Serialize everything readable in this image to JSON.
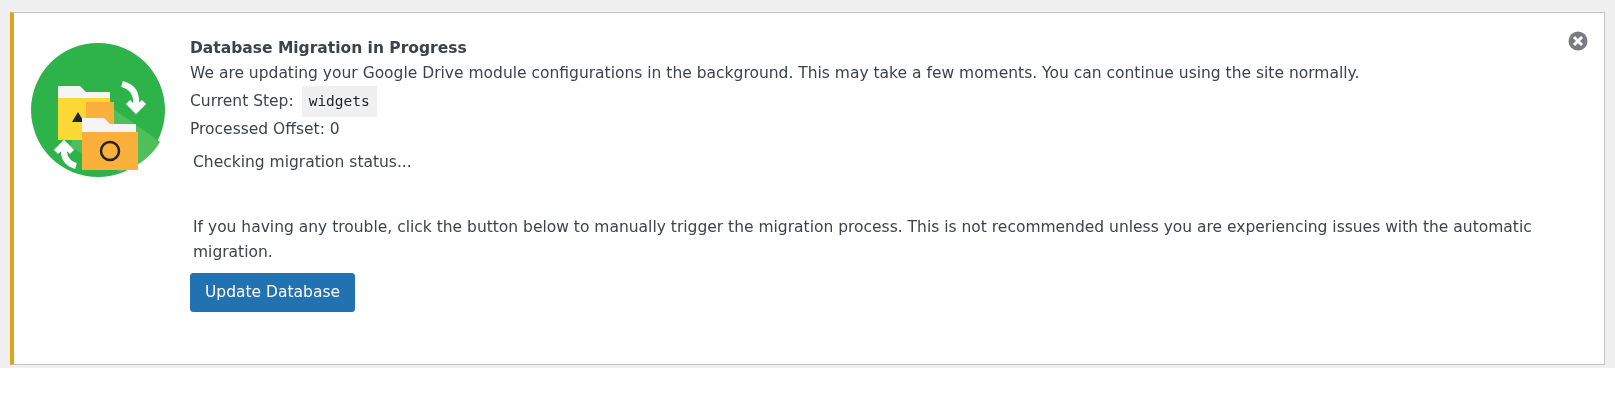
{
  "notice": {
    "title": "Database Migration in Progress",
    "description": "We are updating your Google Drive module configurations in the background. This may take a few moments. You can continue using the site normally.",
    "current_step_label": "Current Step:",
    "current_step": "widgets",
    "processed_offset": "Processed Offset: 0",
    "status": "Checking migration status...",
    "help_text": "If you having any trouble, click the button below to manually trigger the migration process. This is not recommended unless you are experiencing issues with the automatic migration.",
    "button": "Update Database"
  }
}
